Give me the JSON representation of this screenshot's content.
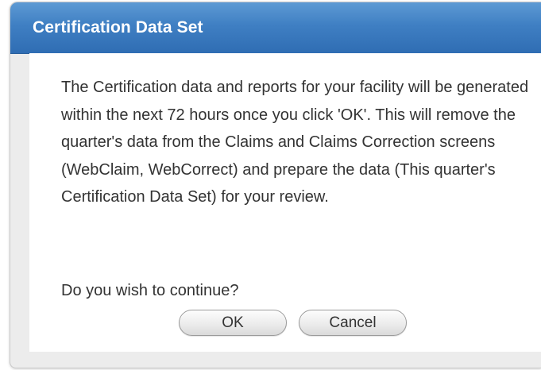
{
  "dialog": {
    "title": "Certification Data Set",
    "message": "The Certification data and reports for your facility will be generated within the next 72 hours once you click 'OK'.  This will remove the quarter's data from the Claims and Claims Correction screens (WebClaim, WebCorrect) and prepare the data (This quarter's Certification Data Set) for your review.",
    "question": "Do you wish to continue?",
    "buttons": {
      "ok_label": "OK",
      "cancel_label": "Cancel"
    }
  },
  "colors": {
    "title_bar": "#3f7fc3",
    "title_text": "#ffffff",
    "body_text": "#333333",
    "frame_background": "#ececec",
    "panel_background": "#ffffff"
  }
}
